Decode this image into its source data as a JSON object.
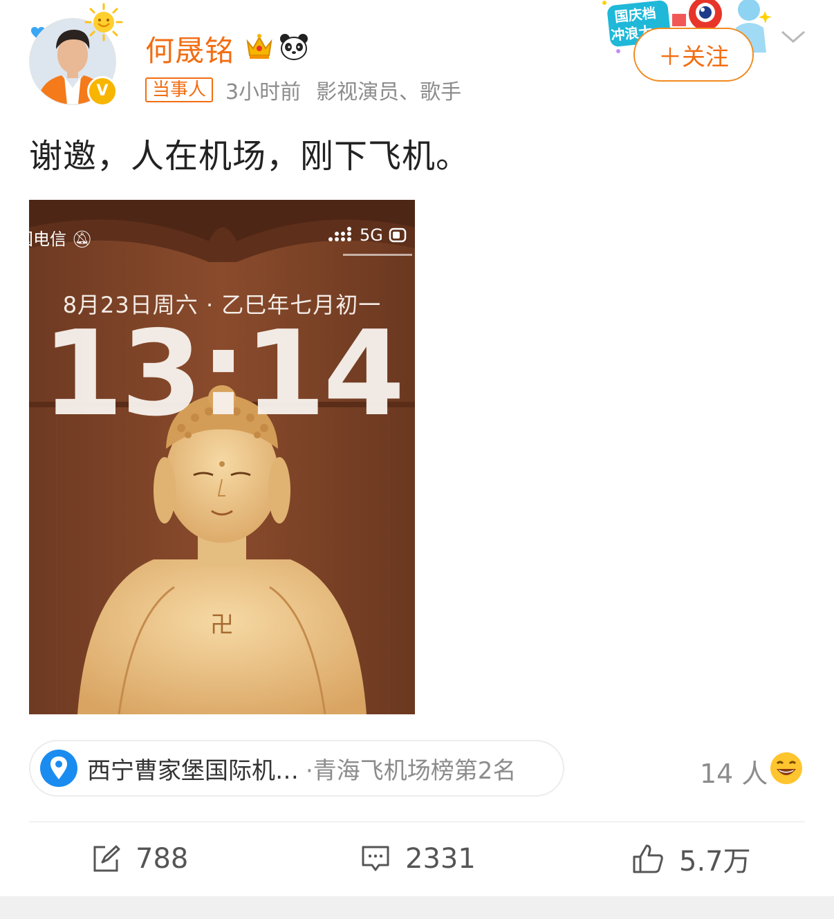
{
  "author": {
    "name": "何晟铭",
    "role_tag": "当事人",
    "time": "3小时前",
    "identity": "影视演员、歌手",
    "badge_icons": [
      "crown-icon",
      "panda-icon"
    ],
    "verified": true
  },
  "header": {
    "follow_label": "＋关注",
    "banner_text": "国庆档冲浪大",
    "more_icon": "chevron-down-icon"
  },
  "post": {
    "text": "谢邀，人在机场，刚下飞机。"
  },
  "image": {
    "carrier": "中国电信",
    "network": "5G",
    "date": "8月23日周六 · 乙巳年七月初一",
    "clock": "13:14"
  },
  "location": {
    "name": "西宁曹家堡国际机…",
    "rank": "·青海飞机场榜第2名",
    "count": "14 人"
  },
  "actions": {
    "repost_count": "788",
    "comment_count": "2331",
    "like_count": "5.7万"
  },
  "colors": {
    "brand_orange": "#f26d12",
    "location_blue": "#1a8cf0",
    "verified_yellow": "#f7b500"
  }
}
